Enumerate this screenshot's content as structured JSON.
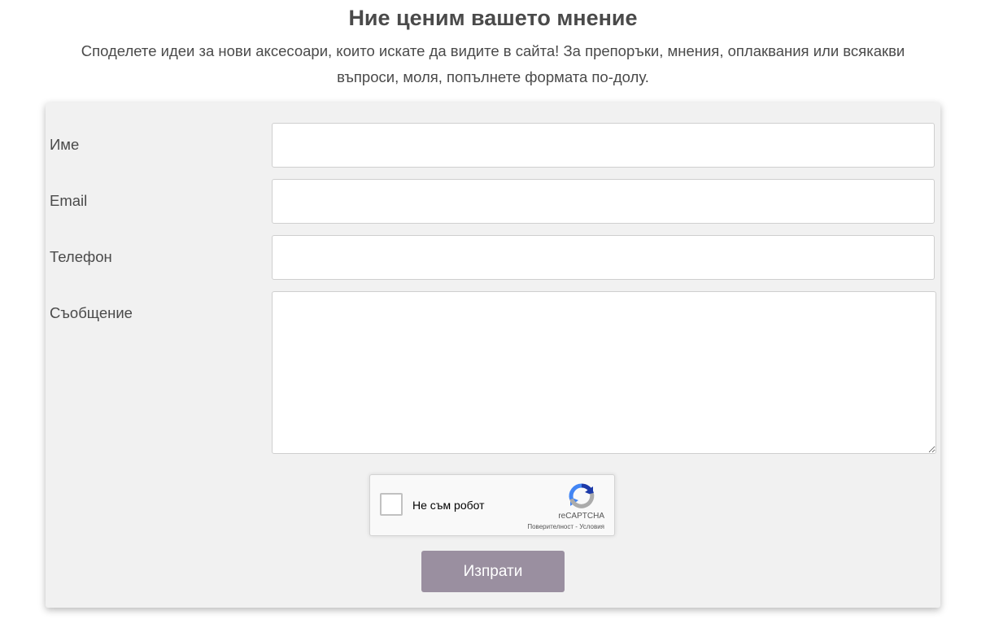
{
  "header": {
    "title": "Ние ценим вашето мнение",
    "intro": "Споделете идеи за нови аксесоари, които искате да видите в сайта! За препоръки, мнения, оплаквания или всякакви въпроси, моля, попълнете формата по-долу."
  },
  "form": {
    "name_label": "Име",
    "name_value": "",
    "email_label": "Email",
    "email_value": "",
    "phone_label": "Телефон",
    "phone_value": "",
    "message_label": "Съобщение",
    "message_value": "",
    "submit_label": "Изпрати"
  },
  "captcha": {
    "label": "Не съм робот",
    "brand": "reCAPTCHA",
    "privacy_link": "Поверителност",
    "separator": "-",
    "terms_link": "Условия",
    "checked": false,
    "logo_icon": "recaptcha-logo-icon"
  },
  "colors": {
    "card_background": "#f1f1f1",
    "button_background": "#9a8fa0",
    "text": "#4a4a4a"
  }
}
